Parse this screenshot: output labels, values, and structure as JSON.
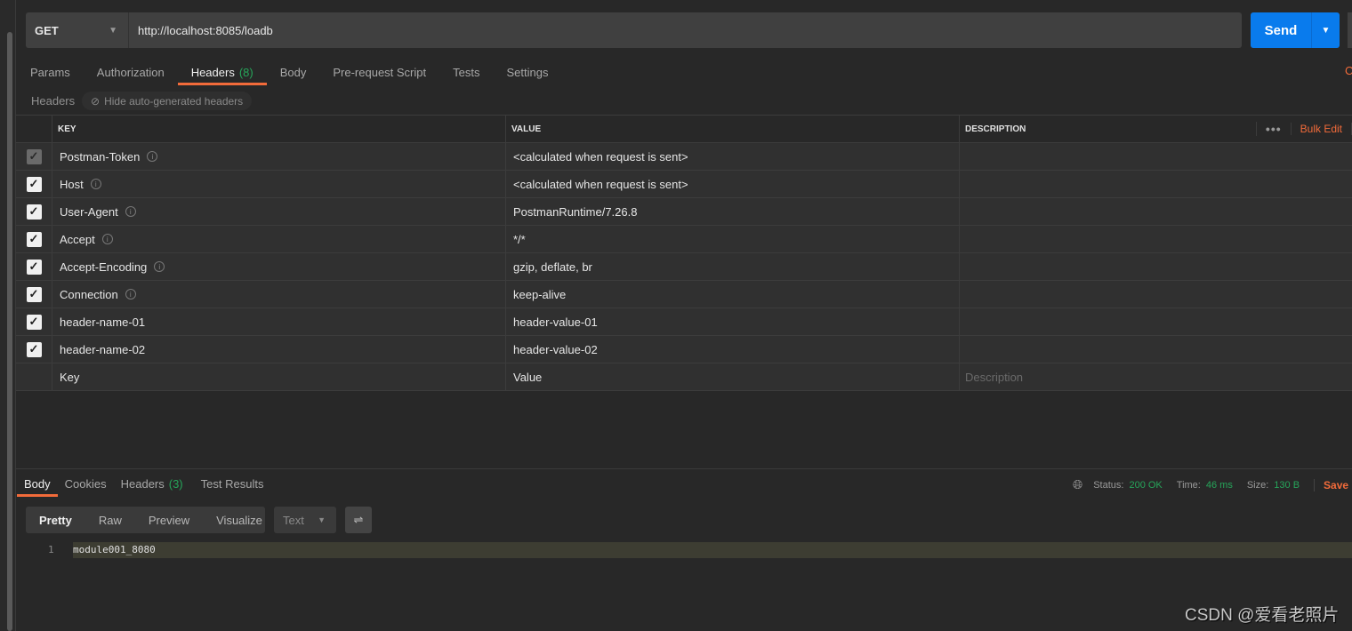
{
  "request": {
    "method": "GET",
    "url": "http://localhost:8085/loadb",
    "send_label": "Send"
  },
  "request_tabs": [
    {
      "label": "Params"
    },
    {
      "label": "Authorization"
    },
    {
      "label": "Headers",
      "count": "(8)"
    },
    {
      "label": "Body"
    },
    {
      "label": "Pre-request Script"
    },
    {
      "label": "Tests"
    },
    {
      "label": "Settings"
    }
  ],
  "cookies_stub": "C",
  "headers_section": {
    "label": "Headers",
    "hide_auto": "Hide auto-generated headers"
  },
  "table": {
    "columns": {
      "key": "KEY",
      "value": "VALUE",
      "description": "DESCRIPTION"
    },
    "more": "•••",
    "bulk_edit": "Bulk Edit",
    "rows": [
      {
        "key": "Postman-Token",
        "value": "<calculated when request is sent>",
        "checked": true,
        "disabled": true,
        "info": true
      },
      {
        "key": "Host",
        "value": "<calculated when request is sent>",
        "checked": true,
        "info": true
      },
      {
        "key": "User-Agent",
        "value": "PostmanRuntime/7.26.8",
        "checked": true,
        "info": true
      },
      {
        "key": "Accept",
        "value": "*/*",
        "checked": true,
        "info": true
      },
      {
        "key": "Accept-Encoding",
        "value": "gzip, deflate, br",
        "checked": true,
        "info": true
      },
      {
        "key": "Connection",
        "value": "keep-alive",
        "checked": true,
        "info": true
      },
      {
        "key": "header-name-01",
        "value": "header-value-01",
        "checked": true
      },
      {
        "key": "header-name-02",
        "value": "header-value-02",
        "checked": true
      }
    ],
    "placeholders": {
      "key": "Key",
      "value": "Value",
      "description": "Description"
    }
  },
  "response": {
    "tabs": [
      {
        "label": "Body"
      },
      {
        "label": "Cookies"
      },
      {
        "label": "Headers",
        "count": "(3)"
      },
      {
        "label": "Test Results"
      }
    ],
    "status_label": "Status:",
    "status": "200 OK",
    "time_label": "Time:",
    "time": "46 ms",
    "size_label": "Size:",
    "size": "130 B",
    "save": "Save",
    "formats": [
      "Pretty",
      "Raw",
      "Preview",
      "Visualize"
    ],
    "type": "Text",
    "lines": [
      {
        "no": "1",
        "text": "module001_8080"
      }
    ]
  },
  "watermark": "CSDN @爱看老照片",
  "colors": {
    "accent": "#f26b3a",
    "send": "#097bed",
    "success": "#26a55a"
  }
}
